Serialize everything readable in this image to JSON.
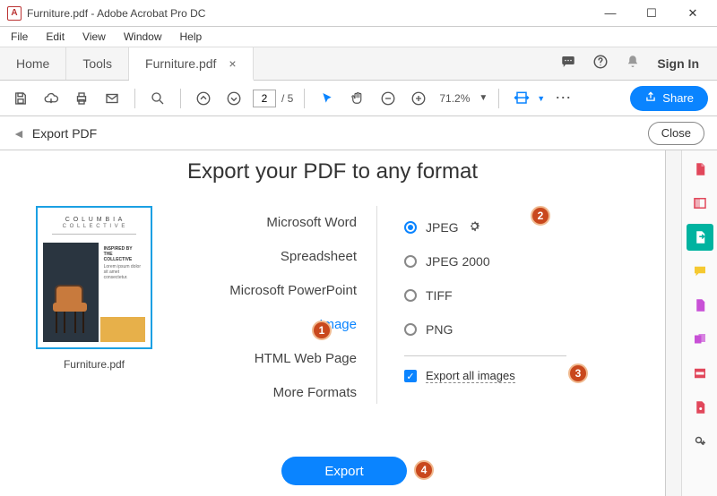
{
  "titlebar": {
    "filename": "Furniture.pdf",
    "appname": "Adobe Acrobat Pro DC"
  },
  "menu": {
    "file": "File",
    "edit": "Edit",
    "view": "View",
    "window": "Window",
    "help": "Help"
  },
  "tabs": {
    "home": "Home",
    "tools": "Tools",
    "doc": "Furniture.pdf",
    "signin": "Sign In"
  },
  "toolbar": {
    "page_current": "2",
    "page_total": "/ 5",
    "zoom": "71.2%",
    "share": "Share"
  },
  "subheader": {
    "title": "Export PDF",
    "close": "Close"
  },
  "main": {
    "heading": "Export your PDF to any format",
    "thumbnail_name": "Furniture.pdf",
    "thumb_brand1": "C O L U M B I A",
    "thumb_brand2": "C O L L E C T I V E",
    "categories": {
      "word": "Microsoft Word",
      "spreadsheet": "Spreadsheet",
      "ppt": "Microsoft PowerPoint",
      "image": "Image",
      "html": "HTML Web Page",
      "more": "More Formats"
    },
    "image_options": {
      "jpeg": "JPEG",
      "jpeg2000": "JPEG 2000",
      "tiff": "TIFF",
      "png": "PNG",
      "export_all": "Export all images"
    },
    "export_btn": "Export"
  },
  "badges": {
    "1": "1",
    "2": "2",
    "3": "3",
    "4": "4"
  }
}
